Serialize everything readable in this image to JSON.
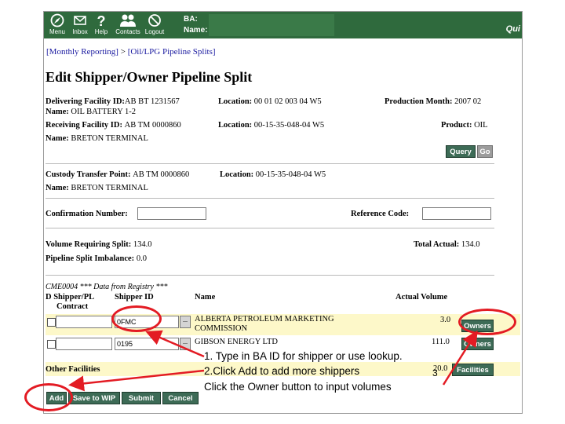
{
  "nav": [
    {
      "label": "Menu",
      "icon": "compass-icon"
    },
    {
      "label": "Inbox",
      "icon": "envelope-icon"
    },
    {
      "label": "Help",
      "icon": "question-icon"
    },
    {
      "label": "Contacts",
      "icon": "people-icon"
    },
    {
      "label": "Logout",
      "icon": "no-entry-icon"
    }
  ],
  "header": {
    "ba_label": "BA:",
    "name_label": "Name:",
    "quick": "Qui"
  },
  "breadcrumb": {
    "parent": "[Monthly Reporting]",
    "separator": ">",
    "current": "[Oil/LPG Pipeline Splits]"
  },
  "page_title": "Edit Shipper/Owner Pipeline Split",
  "facility": {
    "delivering_label": "Delivering Facility ID:",
    "delivering_value": "AB BT 1231567",
    "location1_label": "Location:",
    "location1_value": "00 01 02 003 04 W5",
    "prod_month_label": "Production Month:",
    "prod_month_value": "2007 02",
    "name1_label": "Name:",
    "name1_value": "OIL BATTERY 1-2",
    "receiving_label": "Receiving Facility ID:",
    "receiving_value": "AB TM 0000860",
    "location2_label": "Location:",
    "location2_value": "00-15-35-048-04 W5",
    "product_label": "Product:",
    "product_value": "OIL",
    "name2_label": "Name:",
    "name2_value": "BRETON TERMINAL",
    "query_button": "Query",
    "go_button": "Go"
  },
  "custody": {
    "ctp_label": "Custody Transfer Point:",
    "ctp_value": "AB TM 0000860",
    "location_label": "Location:",
    "location_value": "00-15-35-048-04 W5",
    "name_label": "Name:",
    "name_value": "BRETON TERMINAL"
  },
  "confirmation": {
    "label": "Confirmation Number:",
    "value": ""
  },
  "reference": {
    "label": "Reference Code:",
    "value": ""
  },
  "volume": {
    "requiring_label": "Volume Requiring Split:",
    "requiring_value": "134.0",
    "total_label": "Total Actual:",
    "total_value": "134.0",
    "imbalance_label": "Pipeline Split Imbalance:",
    "imbalance_value": "0.0"
  },
  "registry_note": "CME0004 *** Data from Registry ***",
  "table": {
    "col_d_shipper": "D Shipper/PL",
    "col_contract": "Contract",
    "col_shipper_id": "Shipper ID",
    "col_name": "Name",
    "col_actual_volume": "Actual Volume",
    "lookup_glyph": "...",
    "rows": [
      {
        "shipper_id": "0FMC",
        "name_line1": "ALBERTA PETROLEUM MARKETING",
        "name_line2": "COMMISSION",
        "volume": "3.0",
        "button": "Owners"
      },
      {
        "shipper_id": "0195",
        "name_line1": "GIBSON ENERGY LTD",
        "name_line2": "",
        "volume": "111.0",
        "button": "Owners"
      }
    ],
    "other_label": "Other Facilities",
    "other_volume": "20.0",
    "other_button": "Facilities"
  },
  "actions": {
    "add": "Add",
    "save": "Save to WIP",
    "submit": "Submit",
    "cancel": "Cancel"
  },
  "annotations": {
    "line1": "1. Type in BA ID for shipper or use lookup.",
    "line2": "2.Click Add to add more shippers",
    "line3": "Click the Owner button to input volumes",
    "badge": "3"
  },
  "colors": {
    "topbar": "#2f6a3d",
    "button": "#3d6b56",
    "highlight_row": "#fdf8c9",
    "annotation_red": "#e31b23",
    "link": "#1a1aa0"
  }
}
